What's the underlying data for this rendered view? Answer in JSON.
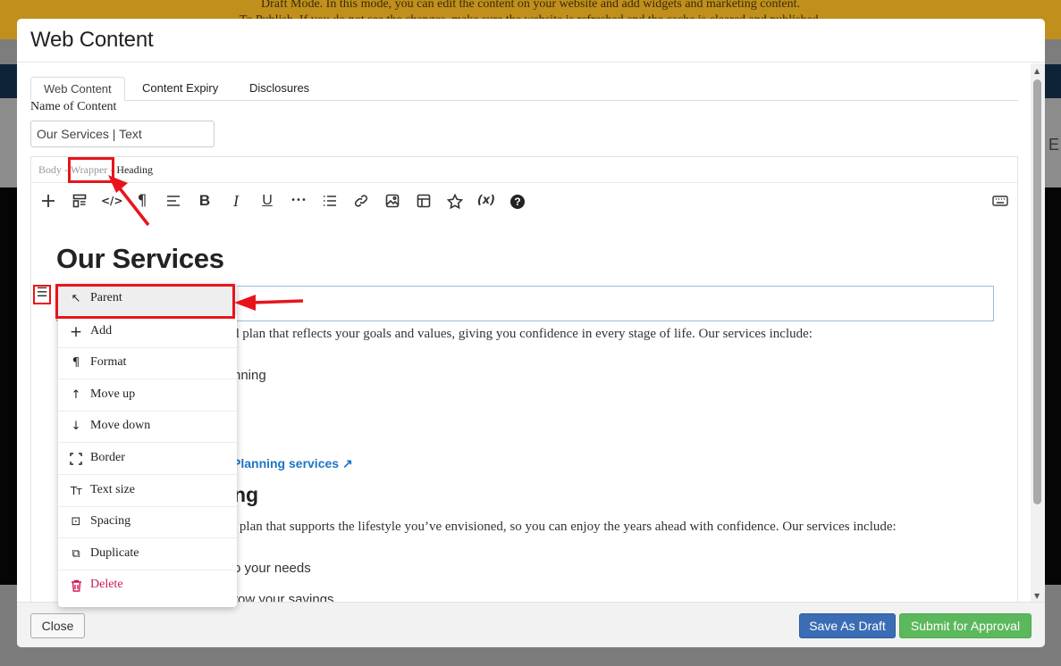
{
  "background": {
    "banner_line1": "Draft Mode. In this mode, you can edit the content on your website and add widgets and marketing content.",
    "banner_line2": "To Publish. If you do not see the changes, make sure the website is refreshed and the cache is cleared and published.",
    "right_letter": "E"
  },
  "modal": {
    "title": "Web Content",
    "tabs": [
      {
        "label": "Web Content",
        "active": true
      },
      {
        "label": "Content Expiry",
        "active": false
      },
      {
        "label": "Disclosures",
        "active": false
      }
    ],
    "name_label": "Name of Content",
    "name_value": "Our Services | Text",
    "breadcrumb": {
      "body": "Body",
      "sep1": "-",
      "wrapper": "Wrapper",
      "sep2": "-",
      "heading": "Heading"
    },
    "toolbar_icons": [
      "plus-icon",
      "block-layout-icon",
      "code-icon",
      "paragraph-icon",
      "align-icon",
      "bold-icon",
      "italic-icon",
      "underline-icon",
      "more-icon",
      "list-icon",
      "link-icon",
      "image-icon",
      "table-icon",
      "star-icon",
      "variable-icon",
      "help-icon",
      "keyboard-icon"
    ],
    "toolbar_glyphs": {
      "bold": "B",
      "italic": "I",
      "underline": "U",
      "paragraph": "¶",
      "code": "</>",
      "more": "•••",
      "variable": "(x)",
      "help": "?"
    },
    "content": {
      "heading": "Our Services",
      "para1_tail": "d plan that reflects your goals and values, giving you confidence in every stage of life. Our services include:",
      "list1_fragment": "nning",
      "link_fragment": "Planning services ↗",
      "h2_fragment": "ng",
      "para2_tail": "t plan that supports the lifestyle you’ve envisioned, so you can enjoy the years ahead with confidence. Our services include:",
      "list2_fragment1": "o your needs",
      "list2_fragment2": "row your savings"
    },
    "drag_handle_glyph": "☰",
    "context_menu": [
      {
        "label": "Parent",
        "icon": "arrow-up-left-icon",
        "glyph": "↖"
      },
      {
        "label": "Add",
        "icon": "plus-icon",
        "glyph": "+"
      },
      {
        "label": "Format",
        "icon": "paragraph-icon",
        "glyph": "¶"
      },
      {
        "label": "Move up",
        "icon": "arrow-up-icon",
        "glyph": "↑"
      },
      {
        "label": "Move down",
        "icon": "arrow-down-icon",
        "glyph": "↓"
      },
      {
        "label": "Border",
        "icon": "border-icon",
        "glyph": "⌜⌟"
      },
      {
        "label": "Text size",
        "icon": "text-size-icon",
        "glyph": "Tт"
      },
      {
        "label": "Spacing",
        "icon": "spacing-icon",
        "glyph": "⊡"
      },
      {
        "label": "Duplicate",
        "icon": "duplicate-icon",
        "glyph": "⧉"
      },
      {
        "label": "Delete",
        "icon": "trash-icon",
        "glyph": "🗑"
      }
    ],
    "footer": {
      "close_label": "Close",
      "draft_label": "Save As Draft",
      "submit_label": "Submit for Approval"
    }
  },
  "colors": {
    "annotation": "#e8141b",
    "draft_button": "#3b6db5",
    "submit_button": "#5cb85c",
    "delete_text": "#d1165a",
    "link": "#1e74c8"
  }
}
